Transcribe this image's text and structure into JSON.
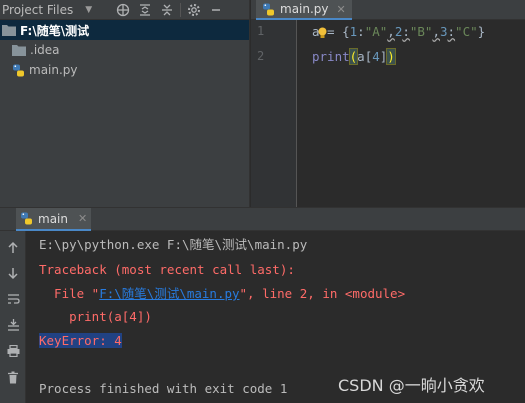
{
  "project_panel": {
    "title": "Project Files",
    "tree": [
      {
        "label": "F:\\随笔\\测试",
        "type": "folder-root"
      },
      {
        "label": ".idea",
        "type": "folder"
      },
      {
        "label": "main.py",
        "type": "python-file"
      }
    ]
  },
  "editor": {
    "tab_label": "main.py",
    "line_numbers": [
      "1",
      "2"
    ],
    "lines": {
      "l1_var": "a",
      "l1_op": " = ",
      "l1_open": "{",
      "l1_k1": "1",
      "l1_c1": ":",
      "l1_v1": "\"A\"",
      "l1_s1": ",",
      "l1_k2": "2",
      "l1_c2": ":",
      "l1_v2": "\"B\"",
      "l1_s2": ",",
      "l1_k3": "3",
      "l1_c3": ":",
      "l1_v3": "\"C\"",
      "l1_close": "}",
      "l2_fn": "print",
      "l2_open": "(",
      "l2_a": "a[",
      "l2_idx": "4",
      "l2_b": "]",
      "l2_close": ")"
    }
  },
  "run": {
    "tab_label": "main",
    "console": {
      "command": "E:\\py\\python.exe F:\\随笔\\测试\\main.py",
      "traceback_header": "Traceback (most recent call last):",
      "file_prefix": "  File \"",
      "file_link": "F:\\随笔\\测试\\main.py",
      "file_suffix": "\", line 2, in <module>",
      "code_line": "    print(a[4])",
      "error": "KeyError: 4",
      "finished": "Process finished with exit code 1"
    }
  },
  "watermark": "CSDN @一晌小贪欢",
  "colors": {
    "accent": "#4a88c7",
    "error_text": "#ff6b68",
    "link": "#287bde",
    "selection": "#214283"
  }
}
